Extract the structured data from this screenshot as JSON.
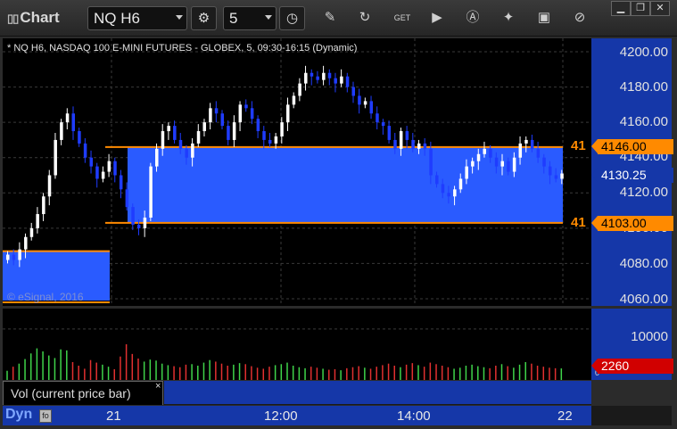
{
  "window": {
    "title": "Chart",
    "symbol": "NQ H6",
    "interval": "5",
    "controls": [
      "minimize",
      "restore",
      "close"
    ]
  },
  "toolbar_icons": [
    "clock-settings-icon",
    "interval-clock-icon",
    "pencil-icon",
    "refresh-icon",
    "get-icon",
    "play-icon",
    "alert-icon",
    "settings-wrench-icon",
    "screenshot-icon",
    "attach-icon"
  ],
  "chart": {
    "header": "* NQ H6, NASDAQ 100 E-MINI FUTURES - GLOBEX, 5, 09:30-16:15 (Dynamic)",
    "copyright": "© eSignal, 2016",
    "y_ticks": [
      "4200.00",
      "4180.00",
      "4160.00",
      "4140.00",
      "4120.00",
      "4100.00",
      "4080.00",
      "4060.00"
    ],
    "upper_line": {
      "badge": "41",
      "value": "4146.00"
    },
    "lower_line": {
      "badge": "41",
      "value": "4103.00"
    },
    "last_price": "4130.25",
    "colors": {
      "up": "#ffffff",
      "down": "#1f3cff",
      "zone": "#2a5bff",
      "level": "#ff8a00",
      "axis_bg": "#1537a8"
    }
  },
  "volume": {
    "label": "Vol (current price bar)",
    "close_glyph": "×",
    "axis_tick": "10000",
    "last_value": "2260",
    "zero_tick": "0"
  },
  "time_axis": {
    "ticks": [
      "21",
      "12:00",
      "14:00",
      "22"
    ],
    "mode_label": "Dyn"
  },
  "chart_data": {
    "type": "candlestick",
    "title": "* NQ H6, NASDAQ 100 E-MINI FUTURES - GLOBEX, 5, 09:30-16:15 (Dynamic)",
    "ylim": [
      4055,
      4205
    ],
    "x_ticks": [
      "21",
      "12:00",
      "14:00",
      "22"
    ],
    "levels": [
      4146.0,
      4103.0
    ],
    "last": 4130.25,
    "closes": [
      4085,
      4082,
      4088,
      4095,
      4100,
      4108,
      4118,
      4130,
      4150,
      4160,
      4165,
      4155,
      4148,
      4140,
      4135,
      4128,
      4132,
      4138,
      4130,
      4122,
      4112,
      4102,
      4100,
      4106,
      4135,
      4145,
      4155,
      4158,
      4150,
      4145,
      4140,
      4148,
      4155,
      4160,
      4168,
      4165,
      4158,
      4150,
      4160,
      4170,
      4168,
      4162,
      4155,
      4150,
      4148,
      4152,
      4160,
      4170,
      4175,
      4182,
      4188,
      4186,
      4184,
      4188,
      4185,
      4182,
      4186,
      4180,
      4175,
      4170,
      4172,
      4165,
      4160,
      4158,
      4150,
      4145,
      4155,
      4150,
      4145,
      4148,
      4145,
      4130,
      4125,
      4120,
      4118,
      4122,
      4128,
      4135,
      4138,
      4142,
      4145,
      4140,
      4135,
      4138,
      4132,
      4140,
      4148,
      4150,
      4145,
      4140,
      4135,
      4130,
      4128,
      4131
    ],
    "volume": [
      1800,
      2600,
      3200,
      4100,
      5200,
      6200,
      5600,
      4800,
      4300,
      6000,
      5800,
      3500,
      2800,
      2200,
      3900,
      3400,
      3000,
      2600,
      2100,
      4600,
      7000,
      5100,
      4200,
      3600,
      4000,
      3800,
      3200,
      2900,
      2700,
      2500,
      3000,
      3100,
      2800,
      3400,
      3900,
      3600,
      3200,
      2800,
      3000,
      3300,
      3100,
      2700,
      2400,
      2200,
      2600,
      2900,
      3100,
      3400,
      2800,
      2500,
      2300,
      2600,
      2400,
      2200,
      2000,
      2100,
      1900,
      2300,
      2500,
      2700,
      2400,
      2200,
      2600,
      2900,
      3200,
      2800,
      2500,
      3000,
      3300,
      2900,
      2600,
      3400,
      3100,
      2800,
      2500,
      2200,
      2400,
      2800,
      3000,
      2700,
      2500,
      2300,
      2800,
      3100,
      2700,
      2400,
      3000,
      3500,
      3200,
      2800,
      2600,
      2400,
      2300,
      2260
    ],
    "volume_ylim": [
      0,
      14000
    ]
  }
}
